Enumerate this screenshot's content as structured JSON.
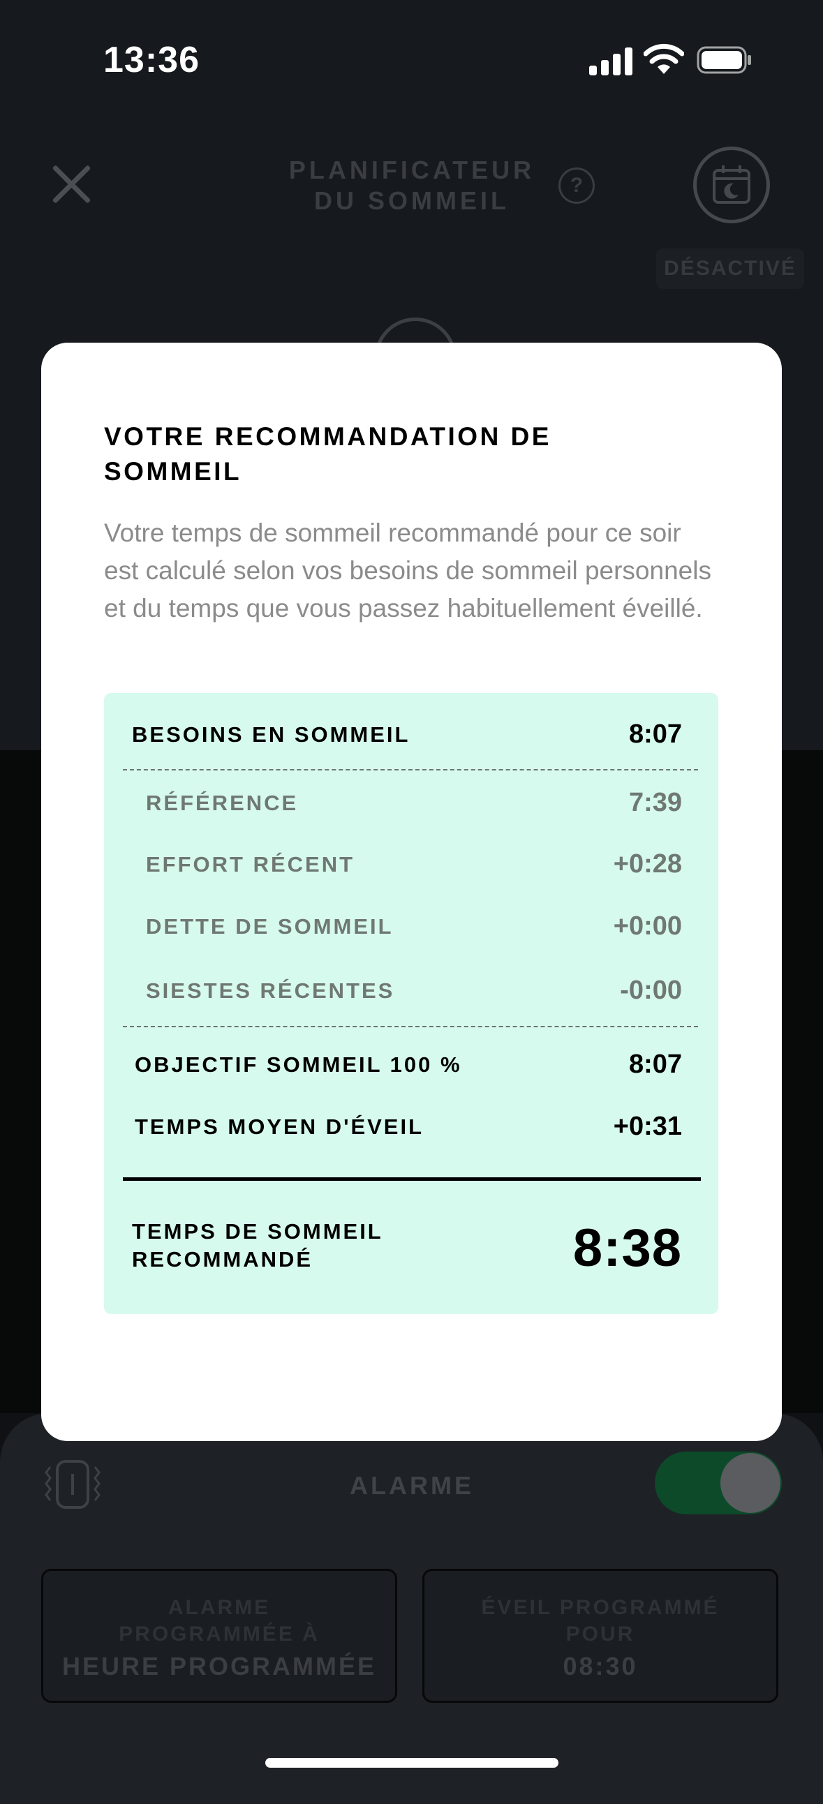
{
  "status_bar": {
    "time": "13:36"
  },
  "header": {
    "title_line1": "PLANIFICATEUR",
    "title_line2": "DU SOMMEIL",
    "help": "?",
    "status_badge": "DÉSACTIVÉ"
  },
  "alarm": {
    "label": "ALARME",
    "toggle_on": true,
    "cards": [
      {
        "line1": "ALARME",
        "line2": "PROGRAMMÉE À",
        "line3": "HEURE PROGRAMMÉE"
      },
      {
        "line1": "ÉVEIL PROGRAMMÉ",
        "line2": "POUR",
        "line3": "08:30"
      }
    ]
  },
  "modal": {
    "title": "VOTRE RECOMMANDATION DE SOMMEIL",
    "description": "Votre temps de sommeil recommandé pour ce soir est calculé selon vos besoins de sommeil personnels et du temps que vous passez habituellement éveillé.",
    "sleep_needs": {
      "label": "BESOINS EN SOMMEIL",
      "value": "8:07"
    },
    "breakdown": [
      {
        "label": "RÉFÉRENCE",
        "value": "7:39"
      },
      {
        "label": "EFFORT RÉCENT",
        "value": "+0:28"
      },
      {
        "label": "DETTE DE SOMMEIL",
        "value": "+0:00"
      },
      {
        "label": "SIESTES RÉCENTES",
        "value": "-0:00"
      }
    ],
    "goal": {
      "label": "OBJECTIF SOMMEIL 100 %",
      "value": "8:07"
    },
    "avg_awake": {
      "label": "TEMPS MOYEN D'ÉVEIL",
      "value": "+0:31"
    },
    "recommended": {
      "label_line1": "TEMPS DE SOMMEIL",
      "label_line2": "RECOMMANDÉ",
      "value": "8:38"
    }
  },
  "colors": {
    "modal_bg": "#ffffff",
    "table_bg": "#d7faee",
    "toggle_on": "#0c4a2a",
    "overlay_bg": "#0f1114"
  }
}
